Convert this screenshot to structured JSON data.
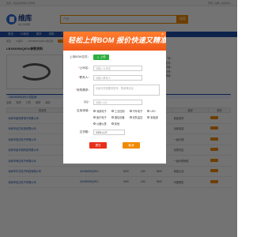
{
  "site": {
    "topbar_left": "您好，欢迎来到电子元件网",
    "topbar_right": "登录 | 注册 | 会员中心",
    "logo_text": "维库",
    "logo_sub": "电子市场网",
    "search_placeholder": "产品",
    "search_button": "搜索",
    "nav": [
      "首页",
      "IC库存",
      "现货",
      "求购",
      "厂商",
      "企业"
    ],
    "breadcrumb": [
      "首页",
      "IC库存",
      "LBX0805NQR10 供应商"
    ],
    "breadcrumb_pill": "LBX0805",
    "product_title": "LBX0805NQR10参数资料",
    "specs": [
      "制造商：LBX08",
      "型号：LBX0805NQR10",
      "封装：0805",
      "批号：2023+",
      "描述：Shell 2272",
      "工作温度：-55°C",
      "包装：卷带"
    ],
    "side_specs": [
      "厂商：",
      "型号：",
      "封装：",
      "批号：",
      "数量："
    ],
    "section_title": "LBX0805NQR10 供应商",
    "filters": [
      "全部",
      "现货",
      "订货",
      "期货",
      "库存"
    ],
    "table_headers": [
      "供应商",
      "型号",
      "数量",
      "厂商",
      "封装",
      "描述",
      "操作"
    ],
    "rows": [
      {
        "supplier": "深圳市盛世联电子有限公司",
        "model": "LBX0805NQR10",
        "qty": "5000",
        "maker": "LBX",
        "pkg": "0805",
        "desc": "原装现货"
      },
      {
        "supplier": "深圳市创芯科技有限公司",
        "model": "LBX0805NQR10",
        "qty": "3000",
        "maker": "LBX",
        "pkg": "0805",
        "desc": "全新原装"
      },
      {
        "supplier": "深圳市恒达电子有限公司",
        "model": "LBX0805NQR10",
        "qty": "2000",
        "maker": "LBX",
        "pkg": "0805",
        "desc": "一级代理"
      },
      {
        "supplier": "深圳市鑫华源科技有限公司",
        "model": "LBX0805NQR10",
        "qty": "1000",
        "maker": "LBX",
        "pkg": "0805",
        "desc": "优势供应"
      },
      {
        "supplier": "深圳市博达电子有限公司",
        "model": "LBX0805NQR10",
        "qty": "6000",
        "maker": "LBX",
        "pkg": "0805",
        "desc": "一级代理销售"
      },
      {
        "supplier": "深圳市华芯电子科技有限公司",
        "model": "LBX0805NQR10",
        "qty": "8000",
        "maker": "LBX",
        "pkg": "0805",
        "desc": "原装正品"
      },
      {
        "supplier": "深圳市宏达电子有限公司",
        "model": "LBX0805NQR10",
        "qty": "4000",
        "maker": "LBX",
        "pkg": "0805",
        "desc": "代理销售"
      }
    ]
  },
  "modal": {
    "title": "轻松上传BOM 报价快速又精准",
    "close": "×",
    "upload_label": "上传BOM文件：",
    "upload_button": "上传",
    "company_label": "公司名：",
    "company_placeholder": "请输入公司名",
    "contact_label": "联系人：",
    "contact_placeholder": "请输入联系人",
    "demand_label": "采购需求：",
    "demand_placeholder": "请填写您需要的型号、数量等信息",
    "qq_label": "QQ：",
    "qq_placeholder": "请输入QQ",
    "industry_label": "应用领域：",
    "industries": [
      "消费电子",
      "工业控制",
      "汽车电子",
      "LED",
      "医疗电子",
      "通信设备",
      "安防监控",
      "新能源",
      "仪器仪表",
      "其他"
    ],
    "date_label": "交货期：",
    "date_value": "2025-4-27",
    "submit_label": "提交",
    "cancel_label": "取消"
  },
  "colors": {
    "accent": "#f08a00",
    "modal_header": "#f05a1a",
    "submit": "#e8301b",
    "upload": "#2eae3f",
    "nav": "#1e4ea8"
  }
}
